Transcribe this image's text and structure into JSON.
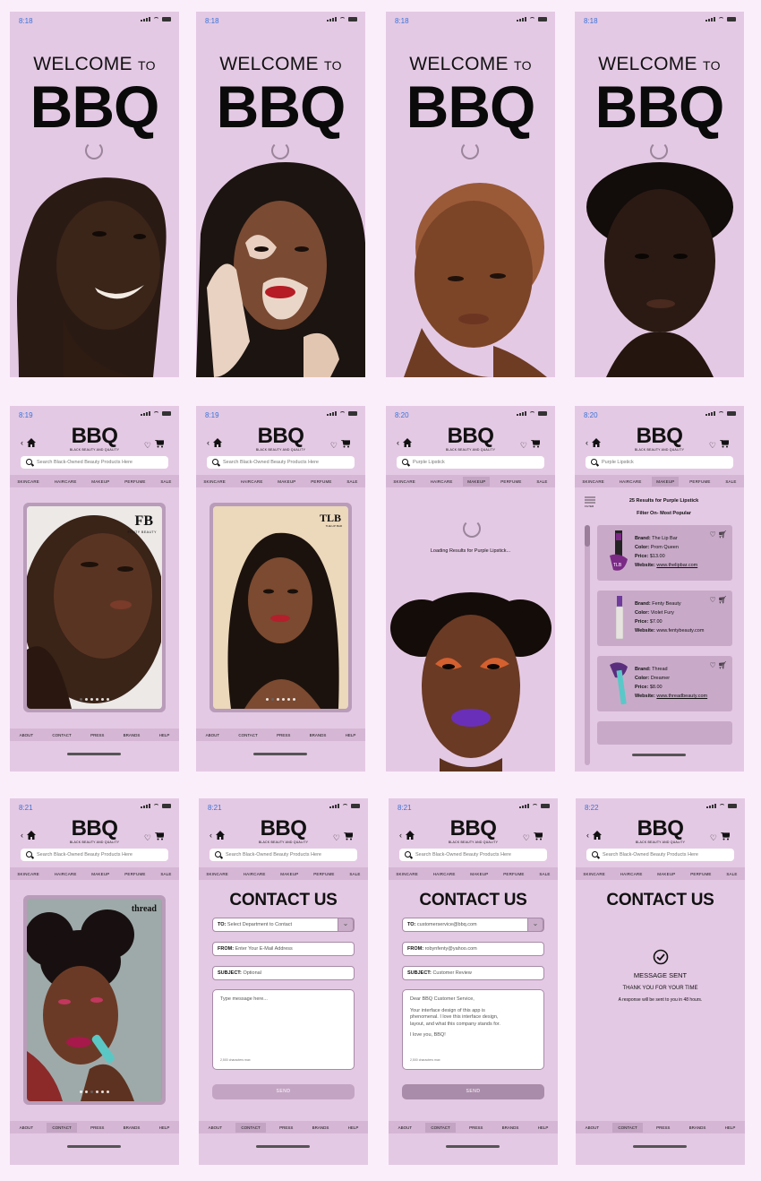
{
  "status": {
    "splash_time": "8:18",
    "row2_times": [
      "8:19",
      "8:19",
      "8:20",
      "8:20"
    ],
    "row3_times": [
      "8:21",
      "8:21",
      "8:21",
      "8:22"
    ]
  },
  "splash": {
    "welcome": "WELCOME",
    "to": "TO",
    "brand": "BBQ"
  },
  "header": {
    "brand": "BBQ",
    "tagline": "BLACK BEAUTY AND QUALITY",
    "back": "‹"
  },
  "search": {
    "placeholder": "Search Black-Owned Beauty Products Here",
    "query": "Purple Lipstick"
  },
  "categories": [
    "SKINCARE",
    "HAIRCARE",
    "MAKEUP",
    "PERFUME",
    "SALE"
  ],
  "footer": [
    "ABOUT",
    "CONTACT",
    "PRESS",
    "BRANDS",
    "HELP"
  ],
  "carousel": {
    "brand_fenty_mark": "FB",
    "brand_fenty_name": "FENTY BEAUTY",
    "brand_tlb": "TLB",
    "brand_tlb_sub": "THE LIP BAR",
    "brand_thread": "thread"
  },
  "loading": {
    "text": "Loading Results for Purple Lipstick..."
  },
  "results": {
    "count_line": "25 Results for Purple Lipstick",
    "filter_label": "FILTER",
    "filter_on": "Filter On-",
    "filter_value": "Most Popular",
    "labels": {
      "brand": "Brand:",
      "color": "Color:",
      "price": "Price:",
      "website": "Website:"
    },
    "items": [
      {
        "brand": "The Lip Bar",
        "color": "Prom Queen",
        "price": "$13.00",
        "website": "www.thelipbar.com",
        "swatch": "#7b2a86"
      },
      {
        "brand": "Fenty Beauty",
        "color": "Violet Fury",
        "price": "$7.00",
        "website": "www.fentybeauty.com",
        "swatch": "#6f3b9c"
      },
      {
        "brand": "Thread",
        "color": "Dreamer",
        "price": "$8.00",
        "website": "www.threadbeauty.com",
        "swatch": "#5b2d7d"
      }
    ]
  },
  "contact": {
    "title": "CONTACT US",
    "to_label": "TO:",
    "to_placeholder": "Select Department to Contact",
    "to_value": "customerservice@bbq.com",
    "from_label": "FROM:",
    "from_placeholder": "Enter Your E-Mail Address",
    "from_value": "robynfenty@yahoo.com",
    "subject_label": "SUBJECT:",
    "subject_placeholder": "Optional",
    "subject_value": "Customer Review",
    "message_placeholder": "Type message here...",
    "message_lines": [
      "Dear BBQ Customer Service,",
      "Your interface design of this app is",
      "phenomenal. I love this interface design,",
      "layout, and what this company stands for.",
      "I love you, BBQ!"
    ],
    "char_count": "2,500 characters max",
    "send": "SEND",
    "sent_title": "MESSAGE SENT",
    "sent_thanks": "THANK YOU FOR YOUR TIME",
    "sent_note": "A response will be sent to you in 48 hours."
  },
  "colors": {
    "phone_bg": "#e4c9e4",
    "bar_bg": "#d5b7d5",
    "accent": "#b99cb9",
    "status_time": "#3a73d6"
  }
}
